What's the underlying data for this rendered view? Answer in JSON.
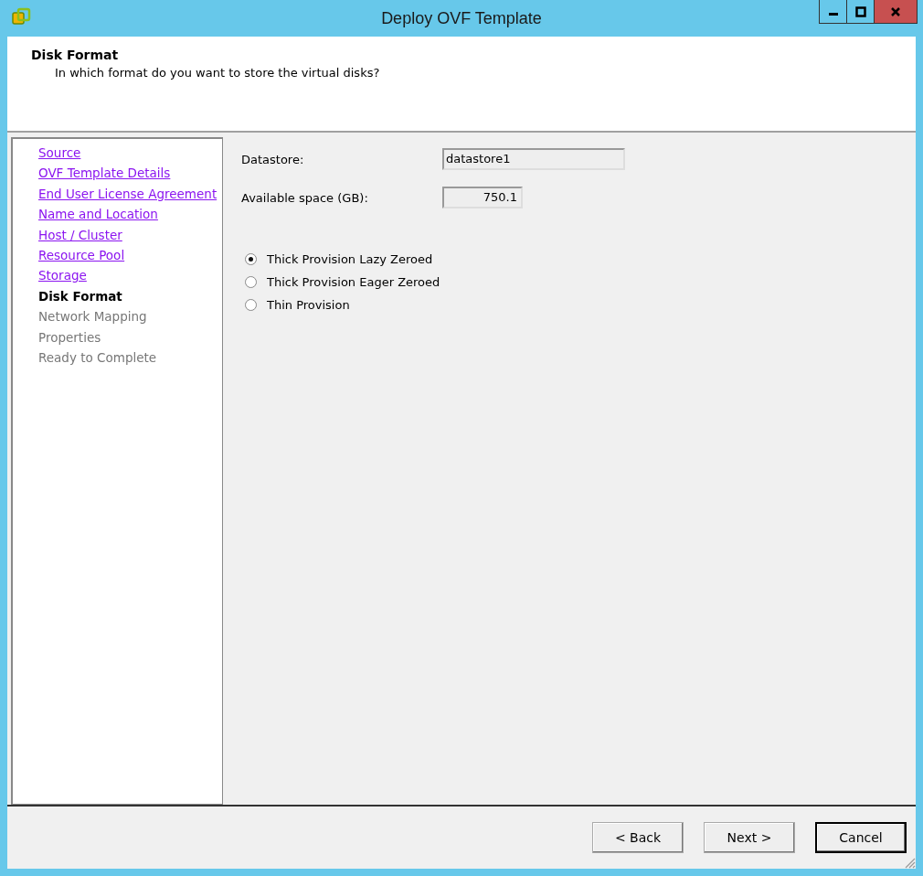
{
  "window": {
    "title": "Deploy OVF Template"
  },
  "header": {
    "title": "Disk Format",
    "subtitle": "In which format do you want to store the virtual disks?"
  },
  "steps": [
    {
      "label": "Source",
      "kind": "done"
    },
    {
      "label": "OVF Template Details",
      "kind": "done"
    },
    {
      "label": "End User License Agreement",
      "kind": "done"
    },
    {
      "label": "Name and Location",
      "kind": "done"
    },
    {
      "label": "Host / Cluster",
      "kind": "done"
    },
    {
      "label": "Resource Pool",
      "kind": "done"
    },
    {
      "label": "Storage",
      "kind": "done"
    },
    {
      "label": "Disk Format",
      "kind": "current"
    },
    {
      "label": "Network Mapping",
      "kind": "pending"
    },
    {
      "label": "Properties",
      "kind": "pending"
    },
    {
      "label": "Ready to Complete",
      "kind": "pending"
    }
  ],
  "fields": [
    {
      "label": "Datastore:",
      "value": "datastore1",
      "kind": "wide"
    },
    {
      "label": "Available space (GB):",
      "value": "750.1",
      "kind": "number"
    }
  ],
  "formats": [
    {
      "label": "Thick Provision Lazy Zeroed",
      "selected": true
    },
    {
      "label": "Thick Provision Eager Zeroed",
      "selected": false
    },
    {
      "label": "Thin Provision",
      "selected": false
    }
  ],
  "buttons": [
    {
      "label": "< Back",
      "default": false
    },
    {
      "label": "Next >",
      "default": false
    },
    {
      "label": "Cancel",
      "default": true
    }
  ]
}
